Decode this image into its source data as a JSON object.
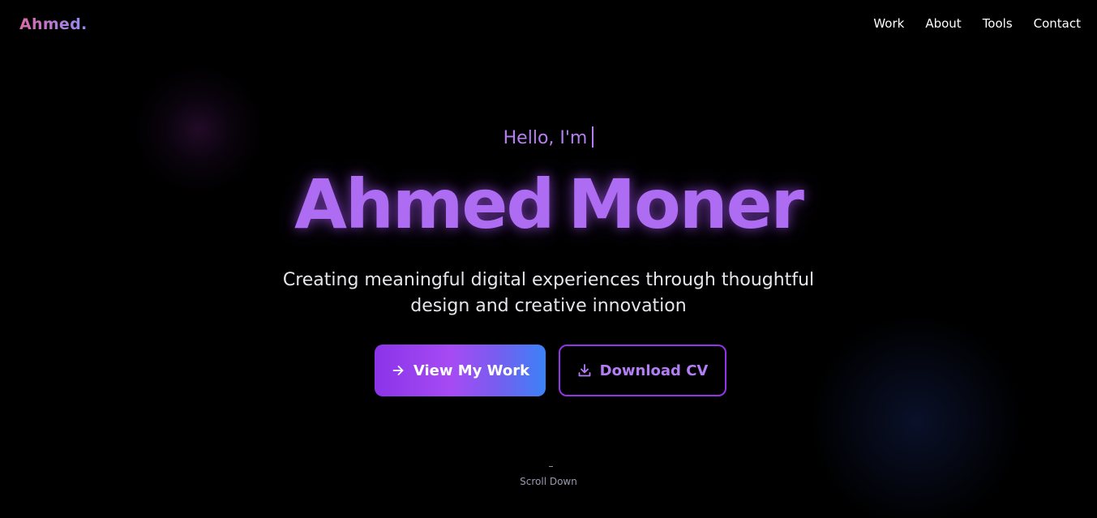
{
  "header": {
    "logo": "Ahmed.",
    "nav": [
      "Work",
      "About",
      "Tools",
      "Contact"
    ]
  },
  "hero": {
    "greeting": "Hello, I'm",
    "first_name": "Ahmed",
    "last_name": "Moner",
    "tagline_line1": "Creating meaningful digital experiences through thoughtful",
    "tagline_line2": "design and creative innovation",
    "primary_button": "View My Work",
    "secondary_button": "Download CV",
    "scroll_label": "Scroll Down"
  },
  "icons": {
    "primary_button": "arrow-right-icon",
    "secondary_button": "download-icon"
  },
  "colors": {
    "background": "#000000",
    "accent_purple": "#a855f7",
    "accent_blue": "#3b82f6",
    "logo_pink": "#d76ba8"
  }
}
